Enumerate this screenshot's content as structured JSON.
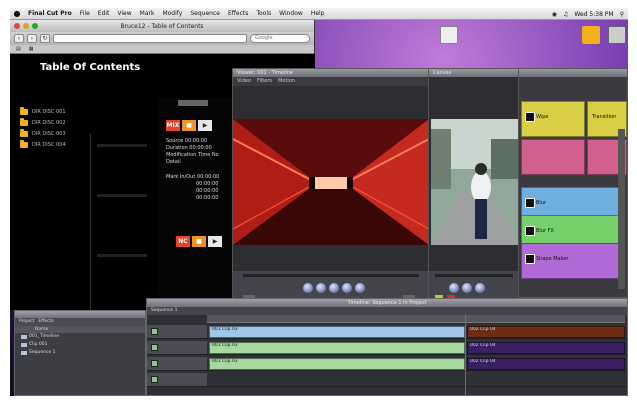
{
  "menubar": {
    "apple": "",
    "items": [
      "Final Cut Pro",
      "File",
      "Edit",
      "View",
      "Mark",
      "Modify",
      "Sequence",
      "Effects",
      "Tools",
      "Window",
      "Help"
    ],
    "right_time": "Wed 5:38 PM"
  },
  "browser": {
    "title": "Bruce12 - Table of Contents",
    "search_placeholder": "Google",
    "toc_title": "Table Of Contents",
    "folders": [
      "DIR DISC 001",
      "DIR DISC 002",
      "DIR DISC 003",
      "DIR DISC 004"
    ]
  },
  "info_panel": {
    "mix_label": "MIX",
    "nc_label": "NC",
    "lines_a": [
      "Source 00:00:00",
      "Duration 00:00:00",
      "Modification Time No",
      "Detail"
    ],
    "lines_b": [
      "Mark In/Out 00:00:00",
      "00:00:00",
      "00:00:00",
      "00:00:00"
    ]
  },
  "viewer": {
    "title": "Viewer: 001 - Timeline",
    "tabs": [
      "Video",
      "Filters",
      "Motion"
    ]
  },
  "canvas": {
    "title": "Canvas"
  },
  "effects": {
    "tiles": [
      {
        "label": "Wipe",
        "color": "#d9cf45"
      },
      {
        "label": "Transition",
        "color": "#d9cf45"
      },
      {
        "label": "",
        "color": "#d1608f"
      },
      {
        "label": "",
        "color": "#d1608f"
      },
      {
        "label": "Blur",
        "color": "#6fb0e0"
      },
      {
        "label": "Blur FX",
        "color": "#77d16a"
      },
      {
        "label": "Shape Maker",
        "color": "#b06ad6"
      }
    ]
  },
  "project": {
    "tabs": [
      "Project",
      "Effects"
    ],
    "header": "Name",
    "rows": [
      "001_Timeline",
      "Clip 001",
      "Sequence 1"
    ]
  },
  "timeline": {
    "title": "Timeline: Sequence 1 in Project",
    "tabs": [
      "Sequence 1"
    ],
    "clips": {
      "v1_a": "001 Clip 03",
      "v1_b": "002 Clip 04",
      "a1_a": "001 Clip 03",
      "a1_b": "002 Clip 04",
      "a2_a": "001 Clip 03",
      "a2_b": "002 Clip 04"
    }
  }
}
